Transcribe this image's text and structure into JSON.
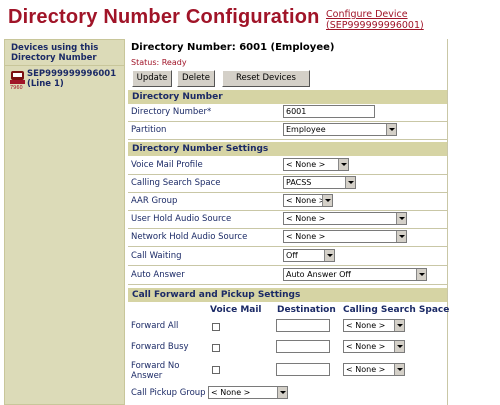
{
  "page": {
    "title": "Directory Number Configuration",
    "configure_link": "Configure Device (SEP999999996001)"
  },
  "sidebar": {
    "header": "Devices using this Directory Number",
    "device_name": "SEP999999996001",
    "device_line": "(Line 1)",
    "icon": "ip-phone-7960-icon"
  },
  "main": {
    "dn_header": "Directory Number:  6001 (Employee)",
    "status_label": "Status:",
    "status_value": "Ready",
    "buttons": {
      "update": "Update",
      "delete": "Delete",
      "reset": "Reset Devices"
    }
  },
  "sections": {
    "directory_number": "Directory Number",
    "dn_settings": "Directory Number Settings",
    "forward": "Call Forward and Pickup Settings"
  },
  "fields": {
    "directory_number": {
      "label": "Directory Number*",
      "value": "6001"
    },
    "partition": {
      "label": "Partition",
      "value": "Employee"
    },
    "voice_mail_profile": {
      "label": "Voice Mail Profile",
      "value": "< None >"
    },
    "css": {
      "label": "Calling Search Space",
      "value": "PACSS"
    },
    "aar_group": {
      "label": "AAR Group",
      "value": "< None >"
    },
    "user_hold": {
      "label": "User Hold Audio Source",
      "value": "< None >"
    },
    "network_hold": {
      "label": "Network Hold Audio Source",
      "value": "< None >"
    },
    "call_waiting": {
      "label": "Call Waiting",
      "value": "Off"
    },
    "auto_answer": {
      "label": "Auto Answer",
      "value": "Auto Answer Off"
    }
  },
  "forward_table": {
    "headers": {
      "voice_mail": "Voice Mail",
      "destination": "Destination",
      "css": "Calling Search Space"
    },
    "rows": [
      {
        "label": "Forward All",
        "css": "< None >"
      },
      {
        "label": "Forward Busy",
        "css": "< None >"
      },
      {
        "label": "Forward No Answer",
        "label_line1": "Forward No",
        "label_line2": "Answer",
        "css": "< None >"
      }
    ],
    "pickup": {
      "label": "Call Pickup Group",
      "value": "< None >"
    }
  },
  "colors": {
    "title": "#a01428",
    "section_bg": "#d6d4a4",
    "sidebar_bg": "#dcdbb8",
    "label_text": "#1b2a66"
  }
}
